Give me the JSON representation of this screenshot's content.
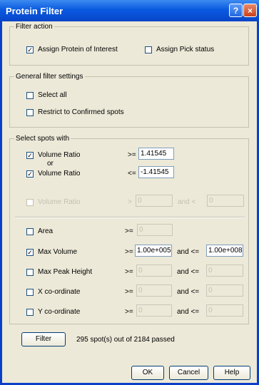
{
  "window": {
    "title": "Protein Filter",
    "help_glyph": "?",
    "close_glyph": "×"
  },
  "filter_action": {
    "legend": "Filter action",
    "assign_poi": {
      "label": "Assign Protein of Interest",
      "checked": true
    },
    "assign_pick": {
      "label": "Assign Pick status",
      "checked": false
    }
  },
  "general": {
    "legend": "General filter settings",
    "select_all": {
      "label": "Select all",
      "checked": false
    },
    "restrict": {
      "label": "Restrict to Confirmed spots",
      "checked": false
    }
  },
  "select": {
    "legend": "Select spots with",
    "vr1": {
      "label": "Volume Ratio",
      "op": ">=",
      "value": "1.41545",
      "checked": true
    },
    "or_label": "or",
    "vr2": {
      "label": "Volume Ratio",
      "op": "<=",
      "value": "-1.41545",
      "checked": true
    },
    "vr_dis": {
      "label": "Volume Ratio",
      "op": ">",
      "value1": "0",
      "and": "and <",
      "value2": "0",
      "checked": false
    },
    "area": {
      "label": "Area",
      "op": ">=",
      "value": "0",
      "checked": false
    },
    "max_volume": {
      "label": "Max Volume",
      "op": ">=",
      "value1": "1.00e+005",
      "and": "and <=",
      "value2": "1.00e+008",
      "checked": true
    },
    "max_peak": {
      "label": "Max Peak Height",
      "op": ">=",
      "value1": "0",
      "and": "and <=",
      "value2": "0",
      "checked": false
    },
    "x_coord": {
      "label": "X co-ordinate",
      "op": ">=",
      "value1": "0",
      "and": "and <=",
      "value2": "0",
      "checked": false
    },
    "y_coord": {
      "label": "Y co-ordinate",
      "op": ">=",
      "value1": "0",
      "and": "and <=",
      "value2": "0",
      "checked": false
    }
  },
  "filter_button": "Filter",
  "status": "295 spot(s) out of 2184 passed",
  "buttons": {
    "ok": "OK",
    "cancel": "Cancel",
    "help": "Help"
  },
  "check_glyph": "✓"
}
